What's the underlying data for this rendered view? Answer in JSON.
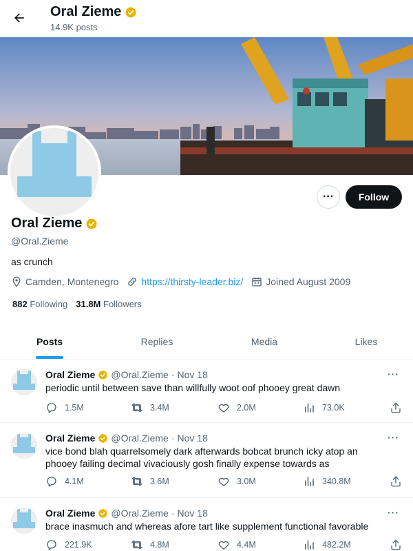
{
  "header": {
    "name": "Oral Zieme",
    "posts_count": "14.9K posts"
  },
  "profile": {
    "name": "Oral Zieme",
    "handle": "@Oral.Zieme",
    "bio": "as crunch",
    "location": "Camden, Montenegro",
    "website": "https://thirsty-leader.biz/",
    "joined": "Joined August 2009",
    "following_count": "882",
    "following_label": "Following",
    "followers_count": "31.8M",
    "followers_label": "Followers"
  },
  "buttons": {
    "more": "···",
    "follow": "Follow"
  },
  "tabs": [
    {
      "label": "Posts"
    },
    {
      "label": "Replies"
    },
    {
      "label": "Media"
    },
    {
      "label": "Likes"
    }
  ],
  "tweets": [
    {
      "name": "Oral Zieme",
      "handle": "@Oral.Zieme",
      "dot": "·",
      "date": "Nov 18",
      "more": "···",
      "text": "periodic until between save than willfully woot oof phooey great dawn",
      "replies": "1.5M",
      "retweets": "3.4M",
      "likes": "2.0M",
      "views": "73.0K"
    },
    {
      "name": "Oral Zieme",
      "handle": "@Oral.Zieme",
      "dot": "·",
      "date": "Nov 18",
      "more": "···",
      "text": "vice bond blah quarrelsomely dark afterwards bobcat brunch icky atop an phooey failing decimal vivaciously gosh finally expense towards as",
      "replies": "4.1M",
      "retweets": "3.6M",
      "likes": "3.0M",
      "views": "340.8M"
    },
    {
      "name": "Oral Zieme",
      "handle": "@Oral.Zieme",
      "dot": "·",
      "date": "Nov 18",
      "more": "···",
      "text": "brace inasmuch and whereas afore tart like supplement functional favorable",
      "replies": "221.9K",
      "retweets": "4.8M",
      "likes": "4.4M",
      "views": "482.2M"
    }
  ],
  "colors": {
    "accent": "#1d9bf0",
    "verified": "#e8b500",
    "avatar_shape": "#8ecae6",
    "text_secondary": "#536471"
  },
  "icons": {
    "back": "arrow-left-icon",
    "verified": "verified-badge-icon",
    "location": "location-pin-icon",
    "link": "link-icon",
    "calendar": "calendar-icon",
    "reply": "reply-icon",
    "retweet": "retweet-icon",
    "like": "heart-icon",
    "views": "views-icon",
    "share": "share-icon"
  }
}
